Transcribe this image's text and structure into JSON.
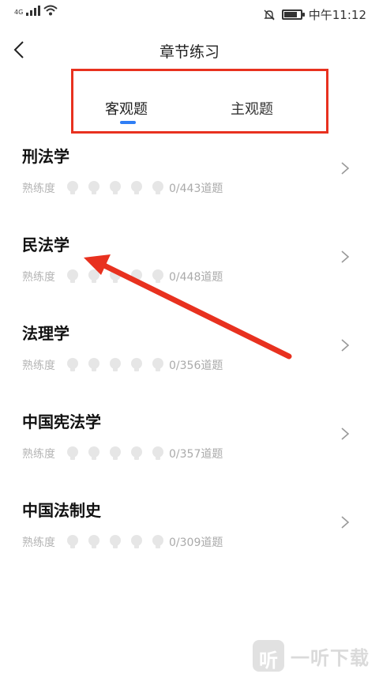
{
  "status_bar": {
    "network": "4G",
    "time": "中午11:12",
    "battery_level": 0.8
  },
  "header": {
    "title": "章节练习"
  },
  "tabs": [
    {
      "label": "客观题",
      "active": true
    },
    {
      "label": "主观题",
      "active": false
    }
  ],
  "chapters": [
    {
      "title": "刑法学",
      "mastery_label": "熟练度",
      "count": "0/443道题"
    },
    {
      "title": "民法学",
      "mastery_label": "熟练度",
      "count": "0/448道题"
    },
    {
      "title": "法理学",
      "mastery_label": "熟练度",
      "count": "0/356道题"
    },
    {
      "title": "中国宪法学",
      "mastery_label": "熟练度",
      "count": "0/357道题"
    },
    {
      "title": "中国法制史",
      "mastery_label": "熟练度",
      "count": "0/309道题"
    }
  ],
  "watermark": {
    "logo_char": "听",
    "text": "一听下载"
  },
  "colors": {
    "accent": "#2f7ef5",
    "annotation": "#e8311f",
    "bulb": "#e6e6e6"
  }
}
